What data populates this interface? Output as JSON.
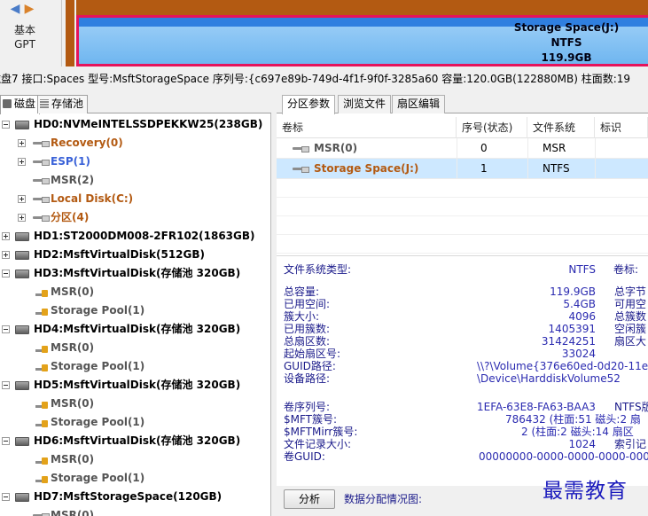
{
  "disk_map": {
    "nav_left_icon": "arrow-left-icon",
    "nav_right_icon": "arrow-right-icon",
    "disk_kind": "基本",
    "disk_scheme": "GPT",
    "partition": {
      "name": "Storage Space(J:)",
      "fs": "NTFS",
      "size": "119.9GB"
    },
    "colors": {
      "system_partition": "#b35a12",
      "selected_border": "#e6135b",
      "partition_fill": "#6fb6f0"
    }
  },
  "infobar": {
    "text": "磁盘7 接口:Spaces  型号:MsftStorageSpace  序列号:{c697e89b-749d-4f1f-9f0f-3285a60  容量:120.0GB(122880MB)  柱面数:19"
  },
  "left_tabs": [
    "磁盘",
    "存储池"
  ],
  "tree": [
    {
      "label": "HD0:NVMeINTELSSDPEKKW25(238GB)",
      "type": "disk",
      "toggle": "minus",
      "level": 0
    },
    {
      "label": "Recovery(0)",
      "type": "partition",
      "color": "orange",
      "toggle": "plus",
      "level": 1
    },
    {
      "label": "ESP(1)",
      "type": "partition",
      "color": "blue",
      "toggle": "plus",
      "level": 1
    },
    {
      "label": "MSR(2)",
      "type": "partition",
      "color": "gray",
      "toggle": "none",
      "level": 1
    },
    {
      "label": "Local Disk(C:)",
      "type": "partition",
      "color": "orange",
      "toggle": "plus",
      "level": 1
    },
    {
      "label": "分区(4)",
      "type": "partition",
      "color": "orange",
      "toggle": "plus",
      "level": 1
    },
    {
      "label": "HD1:ST2000DM008-2FR102(1863GB)",
      "type": "disk",
      "toggle": "plus",
      "level": 0
    },
    {
      "label": "HD2:MsftVirtualDisk(512GB)",
      "type": "disk",
      "toggle": "plus",
      "level": 0
    },
    {
      "label": "HD3:MsftVirtualDisk(存储池 320GB)",
      "type": "disk",
      "toggle": "minus",
      "level": 0
    },
    {
      "label": "MSR(0)",
      "type": "locked",
      "color": "gray",
      "toggle": "none",
      "level": 1
    },
    {
      "label": "Storage Pool(1)",
      "type": "locked",
      "color": "gray",
      "toggle": "none",
      "level": 1
    },
    {
      "label": "HD4:MsftVirtualDisk(存储池 320GB)",
      "type": "disk",
      "toggle": "minus",
      "level": 0
    },
    {
      "label": "MSR(0)",
      "type": "locked",
      "color": "gray",
      "toggle": "none",
      "level": 1
    },
    {
      "label": "Storage Pool(1)",
      "type": "locked",
      "color": "gray",
      "toggle": "none",
      "level": 1
    },
    {
      "label": "HD5:MsftVirtualDisk(存储池 320GB)",
      "type": "disk",
      "toggle": "minus",
      "level": 0
    },
    {
      "label": "MSR(0)",
      "type": "locked",
      "color": "gray",
      "toggle": "none",
      "level": 1
    },
    {
      "label": "Storage Pool(1)",
      "type": "locked",
      "color": "gray",
      "toggle": "none",
      "level": 1
    },
    {
      "label": "HD6:MsftVirtualDisk(存储池 320GB)",
      "type": "disk",
      "toggle": "minus",
      "level": 0
    },
    {
      "label": "MSR(0)",
      "type": "locked",
      "color": "gray",
      "toggle": "none",
      "level": 1
    },
    {
      "label": "Storage Pool(1)",
      "type": "locked",
      "color": "gray",
      "toggle": "none",
      "level": 1
    },
    {
      "label": "HD7:MsftStorageSpace(120GB)",
      "type": "disk",
      "toggle": "minus",
      "level": 0
    },
    {
      "label": "MSR(0)",
      "type": "partition",
      "color": "gray",
      "toggle": "none",
      "level": 1
    }
  ],
  "right_tabs": [
    "分区参数",
    "浏览文件",
    "扇区编辑"
  ],
  "partition_table": {
    "columns": [
      "卷标",
      "序号(状态)",
      "文件系统",
      "标识"
    ],
    "rows": [
      {
        "name": "MSR(0)",
        "index": "0",
        "fs": "MSR",
        "color": "gray",
        "selected": false
      },
      {
        "name": "Storage Space(J:)",
        "index": "1",
        "fs": "NTFS",
        "color": "orange",
        "selected": true
      }
    ]
  },
  "fs_info": {
    "fs_type_label": "文件系统类型:",
    "fs_type_value": "NTFS",
    "volume_label_label": "卷标:",
    "rows": [
      {
        "label": "总容量:",
        "value": "119.9GB",
        "right": "总字节"
      },
      {
        "label": "已用空间:",
        "value": "5.4GB",
        "right": "可用空"
      },
      {
        "label": "簇大小:",
        "value": "4096",
        "right": "总簇数"
      },
      {
        "label": "已用簇数:",
        "value": "1405391",
        "right": "空闲簇"
      },
      {
        "label": "总扇区数:",
        "value": "31424251",
        "right": "扇区大"
      },
      {
        "label": "起始扇区号:",
        "value": "33024",
        "right": ""
      },
      {
        "label": "GUID路径:",
        "value": "\\\\?\\Volume{376e60ed-0d20-11e",
        "right": ""
      },
      {
        "label": "设备路径:",
        "value": "\\Device\\HarddiskVolume52",
        "right": ""
      }
    ],
    "ntfs_rows": [
      {
        "label": "卷序列号:",
        "value": "1EFA-63E8-FA63-BAA3",
        "right": "NTFS版"
      },
      {
        "label": "$MFT簇号:",
        "value": "786432 (柱面:51 磁头:2 扇",
        "right": ""
      },
      {
        "label": "$MFTMirr簇号:",
        "value": "2 (柱面:2 磁头:14 扇区",
        "right": ""
      },
      {
        "label": "文件记录大小:",
        "value": "1024",
        "right": "索引记"
      },
      {
        "label": "卷GUID:",
        "value": "00000000-0000-0000-0000-000",
        "right": ""
      }
    ]
  },
  "bottom": {
    "analyze_button": "分析",
    "alloc_label": "数据分配情况图:"
  },
  "watermark": "最需教育"
}
